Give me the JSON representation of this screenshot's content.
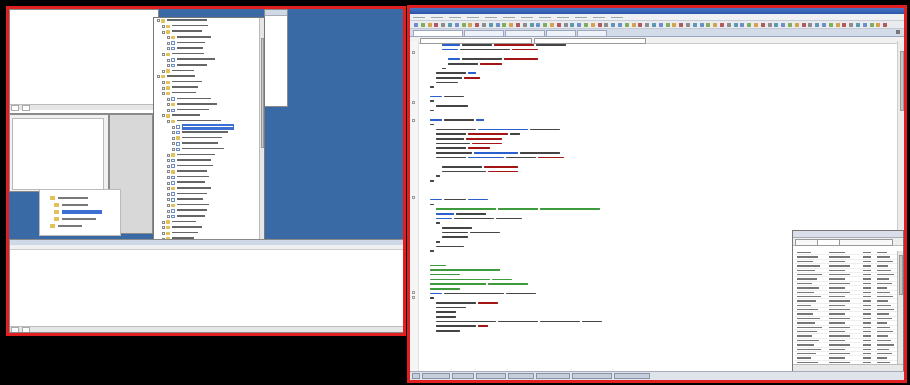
{
  "right_monitor": {
    "ide": {
      "window_title": "",
      "menu_items": [
        "",
        "",
        "",
        "",
        "",
        "",
        "",
        "",
        "",
        "",
        "",
        ""
      ],
      "doc_tabs": [
        "",
        "",
        "",
        "",
        ""
      ],
      "status_text": ""
    },
    "properties_panel": {
      "header": "",
      "tabs": [
        "",
        "",
        ""
      ],
      "footer": ""
    },
    "taskbar": {
      "items": [
        "",
        "",
        "",
        "",
        "",
        "",
        "",
        ""
      ],
      "clock": ""
    }
  },
  "left_monitor": {
    "output_panel_tabs": [
      "",
      ""
    ],
    "top_window_tabs": [
      "",
      ""
    ],
    "solution_tree": {
      "selected_item": ""
    }
  },
  "colors": {
    "highlight_border": "#e02020",
    "desktop": "#3a6aa6",
    "ide_titlebar": "#2b55a8",
    "code_keyword": "#2a5fd0",
    "code_comment": "#3d9a3d",
    "code_string": "#a31515",
    "code_text": "#444444",
    "tree_selection": "#3b6fd1",
    "folder": "#e3c15a"
  },
  "icons": [
    "folder-icon",
    "file-icon",
    "expand-toggle-icon",
    "toolbar-icon",
    "close-icon"
  ]
}
